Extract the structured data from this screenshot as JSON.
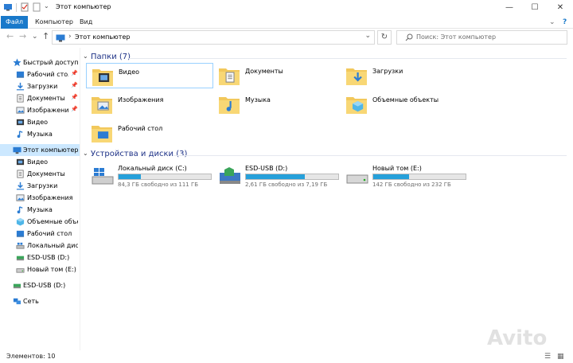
{
  "window": {
    "title": "Этот компьютер",
    "controls": {
      "minimize": "—",
      "maximize": "☐",
      "close": "✕"
    }
  },
  "ribbon": {
    "tabs": [
      "Файл",
      "Компьютер",
      "Вид"
    ],
    "collapse": "⌄",
    "help": "?"
  },
  "address": {
    "back": "←",
    "forward": "→",
    "recent": "⌄",
    "up": "↑",
    "path": "Этот компьютер",
    "chevron": "›",
    "dropdown": "⌄",
    "refresh": "↻"
  },
  "search": {
    "placeholder": "Поиск: Этот компьютер"
  },
  "sidebar": {
    "quick_access": {
      "label": "Быстрый доступ",
      "items": [
        {
          "label": "Рабочий стол",
          "icon": "desktop-icon",
          "pinned": true
        },
        {
          "label": "Загрузки",
          "icon": "downloads-icon",
          "pinned": true
        },
        {
          "label": "Документы",
          "icon": "documents-icon",
          "pinned": true
        },
        {
          "label": "Изображения",
          "icon": "pictures-icon",
          "pinned": true
        },
        {
          "label": "Видео",
          "icon": "video-icon",
          "pinned": false
        },
        {
          "label": "Музыка",
          "icon": "music-icon",
          "pinned": false
        }
      ]
    },
    "this_pc": {
      "label": "Этот компьютер",
      "items": [
        {
          "label": "Видео",
          "icon": "video-icon"
        },
        {
          "label": "Документы",
          "icon": "documents-icon"
        },
        {
          "label": "Загрузки",
          "icon": "downloads-icon"
        },
        {
          "label": "Изображения",
          "icon": "pictures-icon"
        },
        {
          "label": "Музыка",
          "icon": "music-icon"
        },
        {
          "label": "Объемные объекты",
          "icon": "3d-objects-icon"
        },
        {
          "label": "Рабочий стол",
          "icon": "desktop-icon"
        },
        {
          "label": "Локальный диск (C:)",
          "icon": "local-disk-icon"
        },
        {
          "label": "ESD-USB (D:)",
          "icon": "usb-drive-icon"
        },
        {
          "label": "Новый том (E:)",
          "icon": "hdd-icon"
        }
      ]
    },
    "usb": {
      "label": "ESD-USB (D:)"
    },
    "network": {
      "label": "Сеть"
    }
  },
  "main": {
    "folders_header": "Папки (7)",
    "folders": [
      {
        "name": "Видео"
      },
      {
        "name": "Документы"
      },
      {
        "name": "Загрузки"
      },
      {
        "name": "Изображения"
      },
      {
        "name": "Музыка"
      },
      {
        "name": "Объемные объекты"
      },
      {
        "name": "Рабочий стол"
      }
    ],
    "drives_header": "Устройства и диски (3)",
    "drives": [
      {
        "name": "Локальный диск (C:)",
        "free": "84,3 ГБ свободно из 111 ГБ",
        "used_fraction": 0.24
      },
      {
        "name": "ESD-USB (D:)",
        "free": "2,61 ГБ свободно из 7,19 ГБ",
        "used_fraction": 0.64
      },
      {
        "name": "Новый том (E:)",
        "free": "142 ГБ свободно из 232 ГБ",
        "used_fraction": 0.39
      }
    ]
  },
  "status": {
    "items": "Элементов: 10"
  },
  "watermark": "Avito",
  "colors": {
    "accent": "#1979ca",
    "bar_fill": "#26a0da",
    "selection": "#cce8ff",
    "header_text": "#1e3287"
  }
}
